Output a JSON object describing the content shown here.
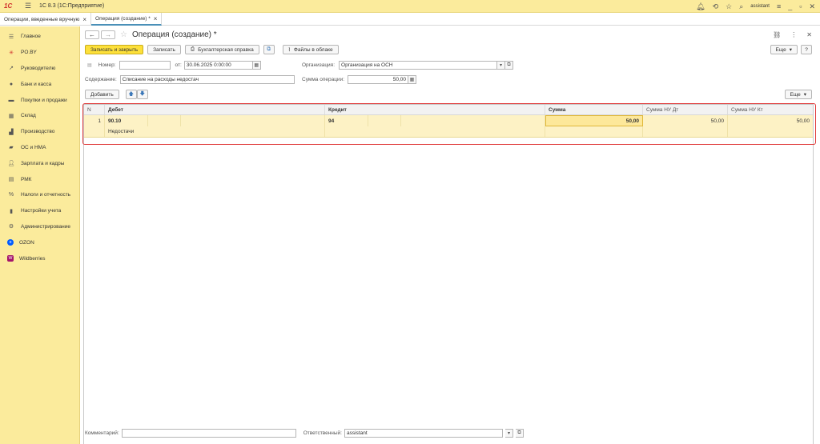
{
  "titlebar": {
    "logo": "1С",
    "title": "1С 8.3  (1С:Предприятие)",
    "user": "assistant"
  },
  "tabs": [
    {
      "label": "Операции, введенные вручную"
    },
    {
      "label": "Операция (создание) *"
    }
  ],
  "sidebar": {
    "items": [
      {
        "label": "Главное",
        "icon": "menu-icon"
      },
      {
        "label": "PO.BY",
        "icon": "asterisk-icon"
      },
      {
        "label": "Руководителю",
        "icon": "chart-line-icon"
      },
      {
        "label": "Банк и касса",
        "icon": "coins-icon"
      },
      {
        "label": "Покупки и продажи",
        "icon": "cart-icon"
      },
      {
        "label": "Склад",
        "icon": "warehouse-icon"
      },
      {
        "label": "Производство",
        "icon": "factory-icon"
      },
      {
        "label": "ОС и НМА",
        "icon": "truck-icon"
      },
      {
        "label": "Зарплата и кадры",
        "icon": "person-icon"
      },
      {
        "label": "РМК",
        "icon": "register-icon"
      },
      {
        "label": "Налоги и отчетность",
        "icon": "percent-icon"
      },
      {
        "label": "Настройки учета",
        "icon": "book-icon"
      },
      {
        "label": "Администрирование",
        "icon": "gear-icon"
      },
      {
        "label": "OZON",
        "icon": "ozon-icon"
      },
      {
        "label": "Wildberries",
        "icon": "wildberries-icon"
      }
    ]
  },
  "form": {
    "title": "Операция (создание) *",
    "toolbar": {
      "save_close": "Записать и закрыть",
      "save": "Записать",
      "report": "Бухгалтерская справка",
      "files": "Файлы в облаке",
      "more": "Еще"
    },
    "fields": {
      "number_label": "Номер:",
      "number_value": "",
      "date_label": "от:",
      "date_value": "30.06.2025  0:00:00",
      "org_label": "Организация:",
      "org_value": "Организация на ОСН",
      "content_label": "Содержание:",
      "content_value": "Списание на расходы недостач",
      "sum_label": "Сумма операции:",
      "sum_value": "50,00"
    },
    "table_toolbar": {
      "add": "Добавить",
      "more": "Еще"
    },
    "table": {
      "headers": {
        "n": "N",
        "debit": "Дебет",
        "credit": "Кредит",
        "sum": "Сумма",
        "nu_dt": "Сумма НУ Дт",
        "nu_kt": "Сумма НУ Кт"
      },
      "rows": [
        {
          "n": "1",
          "debit": "90.10",
          "debit_sub": "Недостачи",
          "credit": "94",
          "sum": "50,00",
          "nu_dt": "50,00",
          "nu_kt": "50,00"
        }
      ]
    },
    "footer": {
      "comment_label": "Комментарий:",
      "comment_value": "",
      "resp_label": "Ответственный:",
      "resp_value": "assistant"
    }
  }
}
